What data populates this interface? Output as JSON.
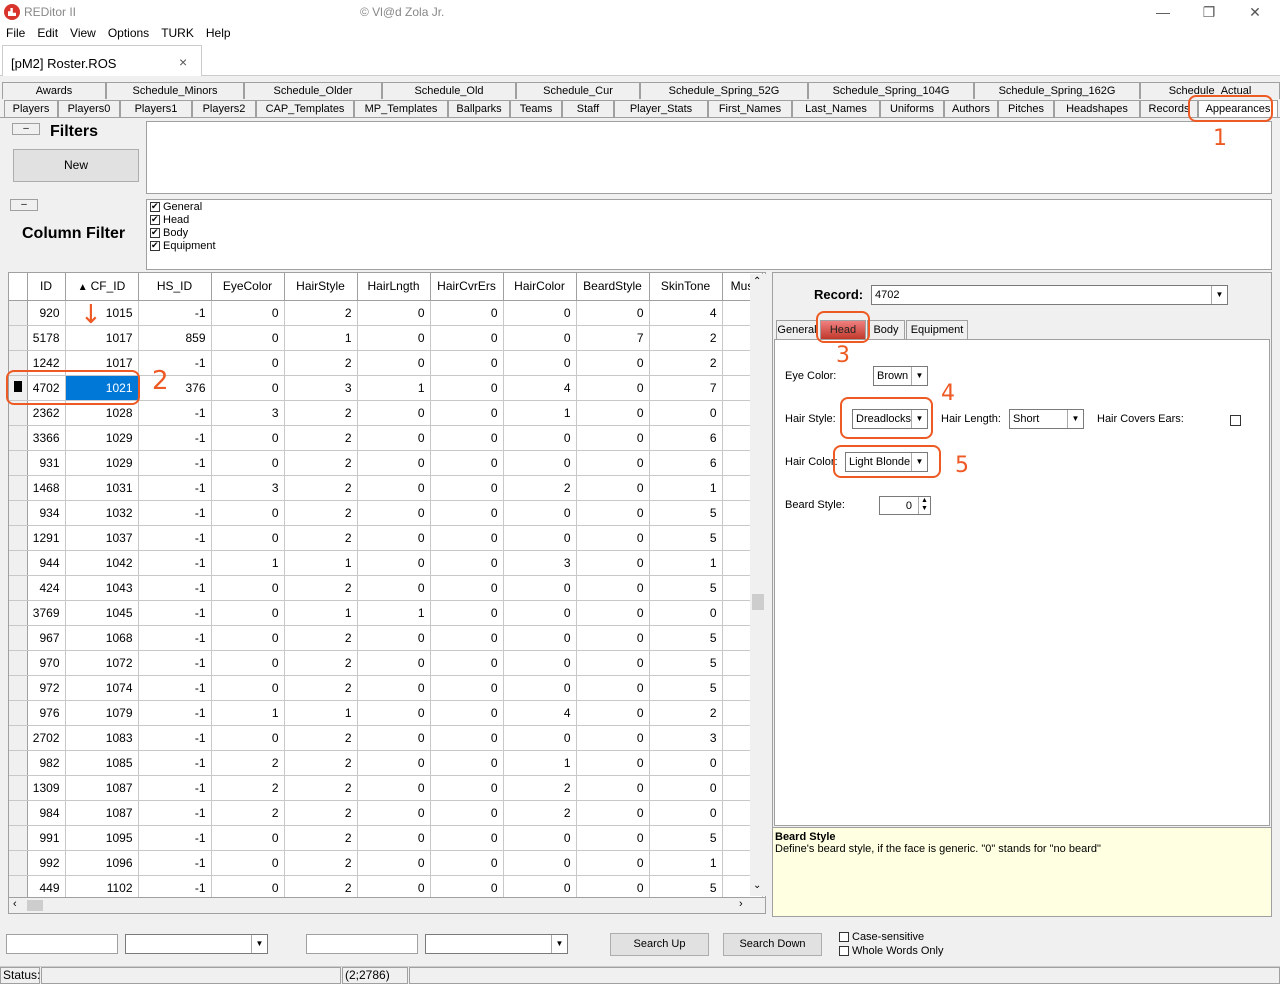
{
  "window": {
    "app_title": "REDitor II",
    "caption": "© Vl@d Zola Jr.",
    "minimize_glyph": "—",
    "restore_glyph": "❐",
    "close_glyph": "✕"
  },
  "menu": [
    "File",
    "Edit",
    "View",
    "Options",
    "TURK",
    "Help"
  ],
  "document_tab": {
    "label": "[pM2] Roster.ROS",
    "close_glyph": "×"
  },
  "table_tabs_row1": [
    "Awards",
    "Schedule_Minors",
    "Schedule_Older",
    "Schedule_Old",
    "Schedule_Cur",
    "Schedule_Spring_52G",
    "Schedule_Spring_104G",
    "Schedule_Spring_162G",
    "Schedule_Actual"
  ],
  "table_tabs_row2": [
    "Players",
    "Players0",
    "Players1",
    "Players2",
    "CAP_Templates",
    "MP_Templates",
    "Ballparks",
    "Teams",
    "Staff",
    "Player_Stats",
    "First_Names",
    "Last_Names",
    "Uniforms",
    "Authors",
    "Pitches",
    "Headshapes",
    "Records",
    "Appearances"
  ],
  "active_table_tab": "Appearances",
  "filters": {
    "collapse_label": "–",
    "title": "Filters",
    "new_button": "New"
  },
  "column_filter": {
    "collapse_label": "–",
    "title": "Column Filter",
    "options": [
      {
        "label": "General",
        "checked": true
      },
      {
        "label": "Head",
        "checked": true
      },
      {
        "label": "Body",
        "checked": true
      },
      {
        "label": "Equipment",
        "checked": true
      }
    ]
  },
  "grid": {
    "sort_glyph": "▲",
    "columns": [
      "ID",
      "CF_ID",
      "HS_ID",
      "EyeColor",
      "HairStyle",
      "HairLngth",
      "HairCvrErs",
      "HairColor",
      "BeardStyle",
      "SkinTone",
      "Mus"
    ],
    "rows": [
      [
        "920",
        "1015",
        "-1",
        "0",
        "2",
        "0",
        "0",
        "0",
        "0",
        "4"
      ],
      [
        "5178",
        "1017",
        "859",
        "0",
        "1",
        "0",
        "0",
        "0",
        "7",
        "2"
      ],
      [
        "1242",
        "1017",
        "-1",
        "0",
        "2",
        "0",
        "0",
        "0",
        "0",
        "2"
      ],
      [
        "4702",
        "1021",
        "376",
        "0",
        "3",
        "1",
        "0",
        "4",
        "0",
        "7"
      ],
      [
        "2362",
        "1028",
        "-1",
        "3",
        "2",
        "0",
        "0",
        "1",
        "0",
        "0"
      ],
      [
        "3366",
        "1029",
        "-1",
        "0",
        "2",
        "0",
        "0",
        "0",
        "0",
        "6"
      ],
      [
        "931",
        "1029",
        "-1",
        "0",
        "2",
        "0",
        "0",
        "0",
        "0",
        "6"
      ],
      [
        "1468",
        "1031",
        "-1",
        "3",
        "2",
        "0",
        "0",
        "2",
        "0",
        "1"
      ],
      [
        "934",
        "1032",
        "-1",
        "0",
        "2",
        "0",
        "0",
        "0",
        "0",
        "5"
      ],
      [
        "1291",
        "1037",
        "-1",
        "0",
        "2",
        "0",
        "0",
        "0",
        "0",
        "5"
      ],
      [
        "944",
        "1042",
        "-1",
        "1",
        "1",
        "0",
        "0",
        "3",
        "0",
        "1"
      ],
      [
        "424",
        "1043",
        "-1",
        "0",
        "2",
        "0",
        "0",
        "0",
        "0",
        "5"
      ],
      [
        "3769",
        "1045",
        "-1",
        "0",
        "1",
        "1",
        "0",
        "0",
        "0",
        "0"
      ],
      [
        "967",
        "1068",
        "-1",
        "0",
        "2",
        "0",
        "0",
        "0",
        "0",
        "5"
      ],
      [
        "970",
        "1072",
        "-1",
        "0",
        "2",
        "0",
        "0",
        "0",
        "0",
        "5"
      ],
      [
        "972",
        "1074",
        "-1",
        "0",
        "2",
        "0",
        "0",
        "0",
        "0",
        "5"
      ],
      [
        "976",
        "1079",
        "-1",
        "1",
        "1",
        "0",
        "0",
        "4",
        "0",
        "2"
      ],
      [
        "2702",
        "1083",
        "-1",
        "0",
        "2",
        "0",
        "0",
        "0",
        "0",
        "3"
      ],
      [
        "982",
        "1085",
        "-1",
        "2",
        "2",
        "0",
        "0",
        "1",
        "0",
        "0"
      ],
      [
        "1309",
        "1087",
        "-1",
        "2",
        "2",
        "0",
        "0",
        "2",
        "0",
        "0"
      ],
      [
        "984",
        "1087",
        "-1",
        "2",
        "2",
        "0",
        "0",
        "2",
        "0",
        "0"
      ],
      [
        "991",
        "1095",
        "-1",
        "0",
        "2",
        "0",
        "0",
        "0",
        "0",
        "5"
      ],
      [
        "992",
        "1096",
        "-1",
        "0",
        "2",
        "0",
        "0",
        "0",
        "0",
        "1"
      ],
      [
        "449",
        "1102",
        "-1",
        "0",
        "2",
        "0",
        "0",
        "0",
        "0",
        "5"
      ]
    ],
    "selected_row_id": "4702"
  },
  "record": {
    "label": "Record:",
    "value": "4702",
    "tabs": [
      "General",
      "Head",
      "Body",
      "Equipment"
    ],
    "active_tab": "Head",
    "eye_color_label": "Eye Color:",
    "eye_color": "Brown",
    "hair_style_label": "Hair Style:",
    "hair_style": "Dreadlocks",
    "hair_length_label": "Hair Length:",
    "hair_length": "Short",
    "hair_covers_ears_label": "Hair Covers Ears:",
    "hair_color_label": "Hair Color:",
    "hair_color": "Light Blonde",
    "beard_style_label": "Beard Style:",
    "beard_style": "0"
  },
  "help": {
    "title": "Beard Style",
    "text": "Define's beard style, if the face is generic. \"0\" stands for \"no beard\""
  },
  "search": {
    "search_up": "Search Up",
    "search_down": "Search Down",
    "case_sensitive": "Case-sensitive",
    "whole_words": "Whole Words Only"
  },
  "status": {
    "label": "Status:",
    "position": "(2;2786)"
  },
  "annotations": [
    "1",
    "2",
    "3",
    "4",
    "5"
  ],
  "colors": {
    "annotation": "#ee5a24",
    "selection": "#0078d7",
    "help_bg": "#ffffe1"
  }
}
